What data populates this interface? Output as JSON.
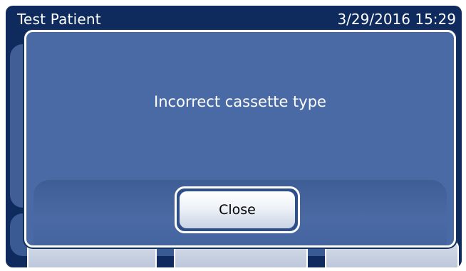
{
  "header": {
    "patient_name": "Test Patient",
    "datetime": "3/29/2016 15:29"
  },
  "dialog": {
    "message": "Incorrect cassette type",
    "close_label": "Close"
  },
  "colors": {
    "screen_background": "#0f2a5c",
    "dialog_background": "#4a6aa6",
    "text": "#ffffff"
  }
}
